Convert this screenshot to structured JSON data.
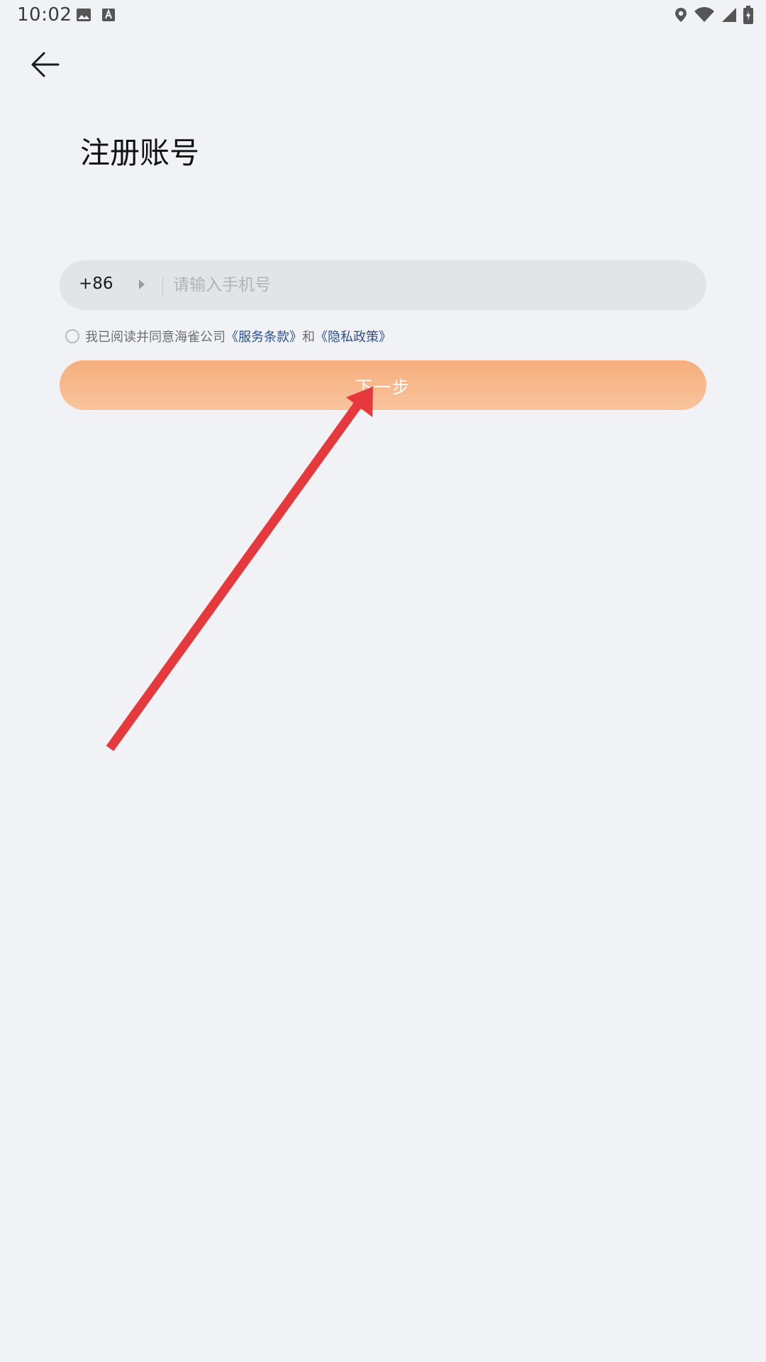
{
  "status_bar": {
    "time": "10:02",
    "left_icons": [
      "image-icon",
      "font-a-icon"
    ],
    "right_icons": [
      "location-icon",
      "wifi-icon",
      "signal-icon",
      "battery-charging-icon"
    ]
  },
  "header": {
    "back_icon": "arrow-left-icon",
    "title": "注册账号"
  },
  "phone": {
    "country_code": "+86",
    "placeholder": "请输入手机号",
    "value": ""
  },
  "agreement": {
    "checked": false,
    "prefix": "我已阅读并同意海雀公司",
    "terms_link": "《服务条款》",
    "conjunction": "和",
    "privacy_link": "《隐私政策》"
  },
  "next_button": {
    "label": "下一步"
  },
  "colors": {
    "background": "#f1f2f6",
    "input_bg": "#e3e4e8",
    "button_gradient_top": "#f6ae7c",
    "button_gradient_bottom": "#f9c49d",
    "link": "#2d4f8e",
    "annotation_arrow": "#e5393e"
  }
}
